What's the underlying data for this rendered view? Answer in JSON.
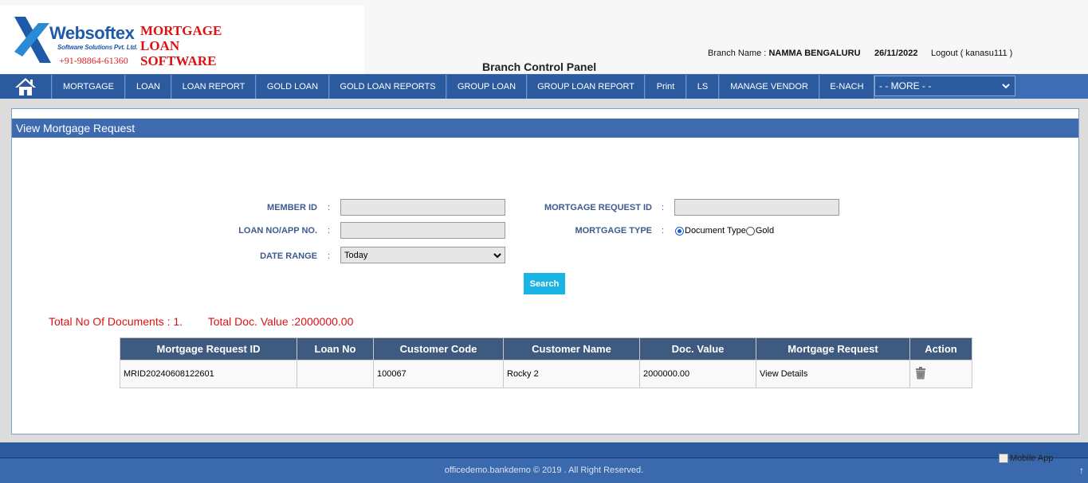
{
  "header": {
    "brand": "Websoftex",
    "brand_sub": "Software Solutions Pvt. Ltd.",
    "phone": "+91-98864-61360",
    "product_line1": "MORTGAGE",
    "product_line2": "LOAN",
    "product_line3": "SOFTWARE",
    "panel_title": "Branch Control Panel",
    "branch_label": "Branch Name :",
    "branch_name": "NAMMA BENGALURU",
    "date": "26/11/2022",
    "logout": "Logout ( kanasu111 )"
  },
  "nav": {
    "items": [
      "MORTGAGE",
      "LOAN",
      "LOAN REPORT",
      "GOLD LOAN",
      "GOLD LOAN REPORTS",
      "GROUP LOAN",
      "GROUP LOAN REPORT",
      "Print",
      "LS",
      "MANAGE VENDOR",
      "E-NACH"
    ],
    "more": "- - MORE - -"
  },
  "panel": {
    "title": "View Mortgage Request"
  },
  "form": {
    "member_id_label": "MEMBER ID",
    "loan_no_label": "LOAN NO/APP NO.",
    "date_range_label": "DATE RANGE",
    "date_range_value": "Today",
    "mortgage_request_id_label": "MORTGAGE REQUEST ID",
    "mortgage_type_label": "MORTGAGE TYPE",
    "type_document": "Document Type",
    "type_gold": "Gold",
    "colon": ":",
    "search": "Search"
  },
  "totals": {
    "documents": "Total No Of Documents : 1.",
    "value": "Total Doc. Value :2000000.00"
  },
  "table": {
    "headers": [
      "Mortgage Request ID",
      "Loan No",
      "Customer Code",
      "Customer Name",
      "Doc. Value",
      "Mortgage Request",
      "Action"
    ],
    "rows": [
      {
        "request_id": "MRID20240608122601",
        "loan_no": "",
        "customer_code": "100067",
        "customer_name": "Rocky 2",
        "doc_value": "2000000.00",
        "mortgage_request": "View Details"
      }
    ]
  },
  "footer": {
    "copyright": "officedemo.bankdemo © 2019 . All Right Reserved.",
    "mobile_app": "Mobile App"
  }
}
